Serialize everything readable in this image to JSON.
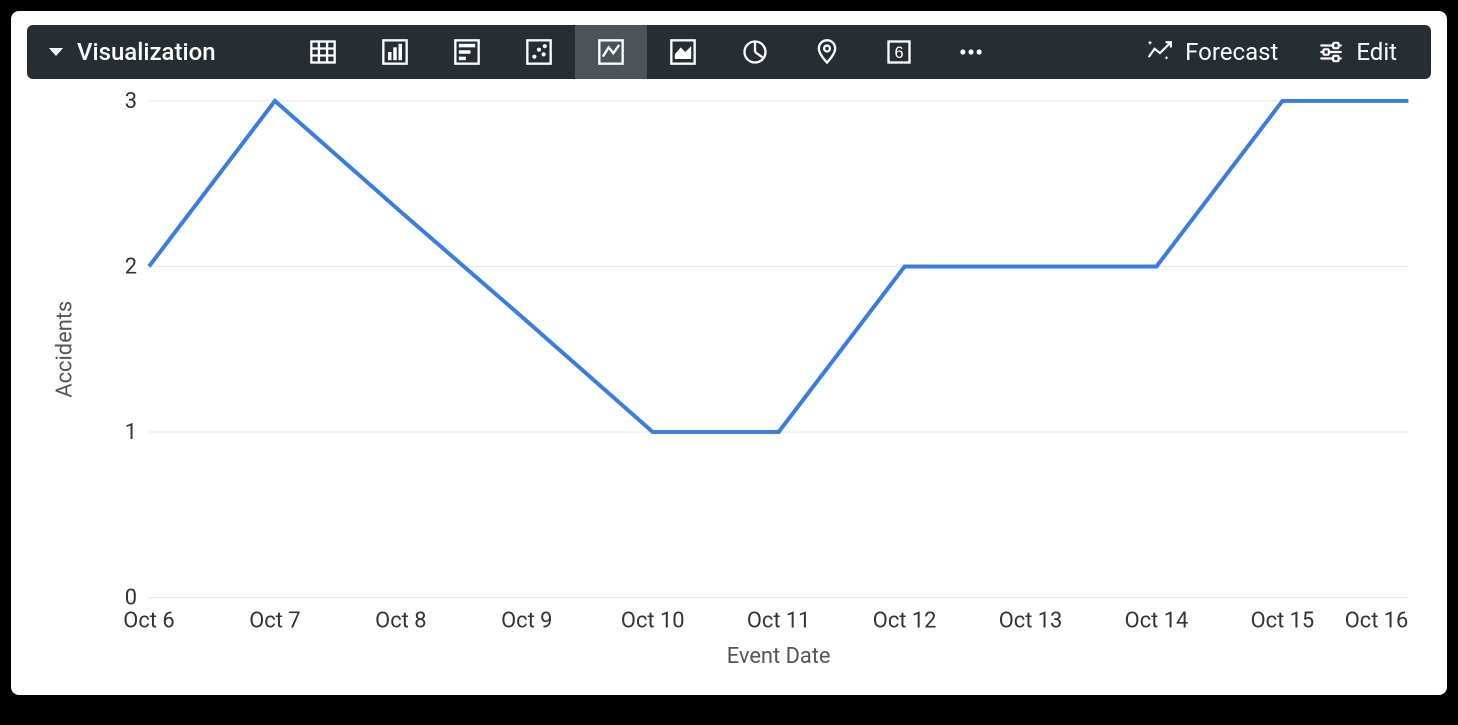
{
  "toolbar": {
    "title": "Visualization",
    "icons": [
      {
        "name": "table-icon",
        "active": false
      },
      {
        "name": "column-icon",
        "active": false
      },
      {
        "name": "bar-icon",
        "active": false
      },
      {
        "name": "scatter-icon",
        "active": false
      },
      {
        "name": "line-icon",
        "active": true
      },
      {
        "name": "area-icon",
        "active": false
      },
      {
        "name": "pie-icon",
        "active": false
      },
      {
        "name": "map-icon",
        "active": false
      },
      {
        "name": "single-value-icon",
        "active": false
      },
      {
        "name": "more-icon",
        "active": false
      }
    ],
    "forecast_label": "Forecast",
    "edit_label": "Edit"
  },
  "chart_data": {
    "type": "line",
    "xlabel": "Event Date",
    "ylabel": "Accidents",
    "ylim": [
      0,
      3
    ],
    "yticks": [
      0,
      1,
      2,
      3
    ],
    "categories": [
      "Oct 6",
      "Oct 7",
      "Oct 8",
      "Oct 9",
      "Oct 10",
      "Oct 11",
      "Oct 12",
      "Oct 13",
      "Oct 14",
      "Oct 15",
      "Oct 16"
    ],
    "series": [
      {
        "name": "Accidents",
        "color": "#3b7ddd",
        "values": [
          2,
          3,
          2.33,
          1.67,
          1,
          1,
          2,
          2,
          2,
          3,
          3
        ]
      }
    ]
  }
}
